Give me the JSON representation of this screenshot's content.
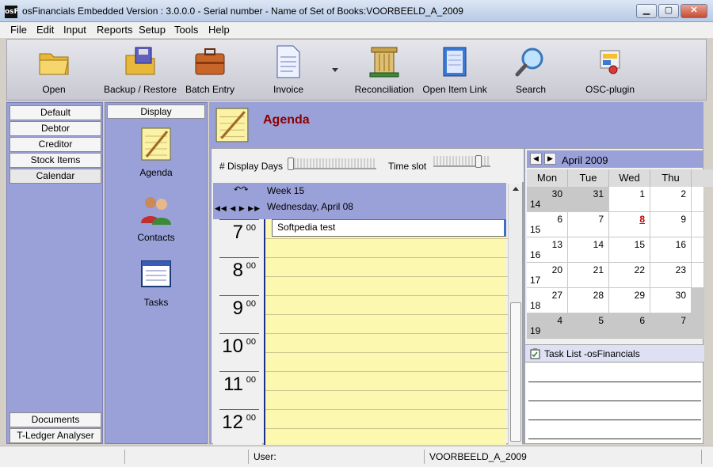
{
  "window": {
    "app_icon_text": "osF",
    "title": "osFinancials Embedded Version : 3.0.0.0 -  Serial number - Name of Set of Books:VOORBEELD_A_2009"
  },
  "menu": [
    "File",
    "Edit",
    "Input",
    "Reports",
    "Setup",
    "Tools",
    "Help"
  ],
  "toolbar": [
    {
      "label": "Open",
      "icon": "folder-icon"
    },
    {
      "label": "Backup / Restore",
      "icon": "backup-icon"
    },
    {
      "label": "Batch Entry",
      "icon": "briefcase-icon"
    },
    {
      "label": "Invoice",
      "icon": "invoice-icon"
    },
    {
      "label": "Reconciliation",
      "icon": "reconciliation-icon"
    },
    {
      "label": "Open Item Link",
      "icon": "notebook-icon"
    },
    {
      "label": "Search",
      "icon": "magnifier-icon"
    },
    {
      "label": "OSC-plugin",
      "icon": "plugin-icon"
    }
  ],
  "leftnav": {
    "top": [
      "Default",
      "Debtor",
      "Creditor",
      "Stock Items",
      "Calendar"
    ],
    "bottom": [
      "Documents",
      "T-Ledger Analyser"
    ]
  },
  "subnav": {
    "header": "Display",
    "items": [
      {
        "label": "Agenda",
        "icon": "agenda-icon"
      },
      {
        "label": "Contacts",
        "icon": "contacts-icon"
      },
      {
        "label": "Tasks",
        "icon": "tasks-icon"
      }
    ]
  },
  "agenda": {
    "title": "Agenda",
    "display_days_label": "# Display Days",
    "time_slot_label": "Time slot",
    "week": "Week  15",
    "date": "Wednesday, April 08",
    "hours": [
      {
        "h": "7",
        "m": "00"
      },
      {
        "h": "8",
        "m": "00"
      },
      {
        "h": "9",
        "m": "00"
      },
      {
        "h": "10",
        "m": "00"
      },
      {
        "h": "11",
        "m": "00"
      },
      {
        "h": "12",
        "m": "00"
      }
    ],
    "event": "Softpedia test"
  },
  "calendar": {
    "month": "April 2009",
    "days": [
      "Mon",
      "Tue",
      "Wed",
      "Thu"
    ],
    "rows": [
      {
        "week": "14",
        "cells": [
          {
            "d": "30",
            "gray": true
          },
          {
            "d": "31",
            "gray": true
          },
          {
            "d": "1"
          },
          {
            "d": "2"
          }
        ]
      },
      {
        "week": "15",
        "cells": [
          {
            "d": "6"
          },
          {
            "d": "7"
          },
          {
            "d": "8",
            "today": true
          },
          {
            "d": "9"
          }
        ]
      },
      {
        "week": "16",
        "cells": [
          {
            "d": "13"
          },
          {
            "d": "14"
          },
          {
            "d": "15"
          },
          {
            "d": "16"
          }
        ]
      },
      {
        "week": "17",
        "cells": [
          {
            "d": "20"
          },
          {
            "d": "21"
          },
          {
            "d": "22"
          },
          {
            "d": "23"
          }
        ]
      },
      {
        "week": "18",
        "cells": [
          {
            "d": "27"
          },
          {
            "d": "28"
          },
          {
            "d": "29"
          },
          {
            "d": "30"
          }
        ]
      },
      {
        "week": "19",
        "cells": [
          {
            "d": "4",
            "gray": true
          },
          {
            "d": "5",
            "gray": true
          },
          {
            "d": "6",
            "gray": true
          },
          {
            "d": "7",
            "gray": true
          }
        ]
      }
    ]
  },
  "tasklist": {
    "title": "Task List -osFinancials"
  },
  "status": {
    "user_label": "User:",
    "book": "VOORBEELD_A_2009"
  }
}
